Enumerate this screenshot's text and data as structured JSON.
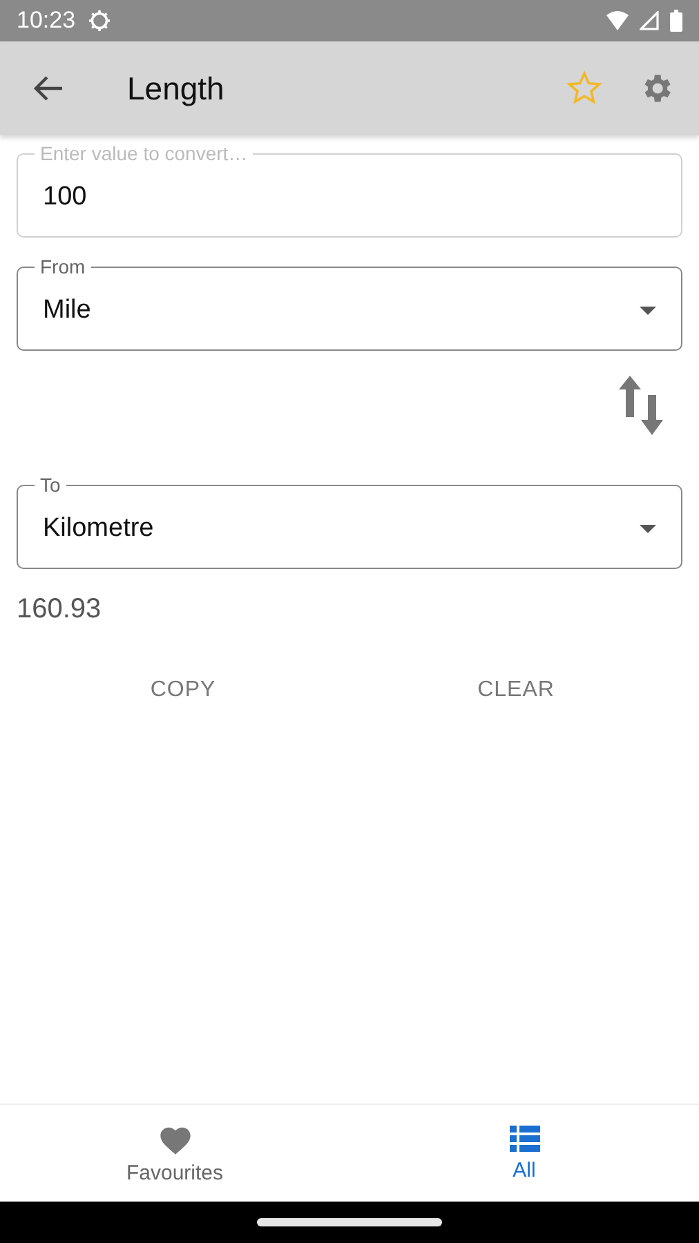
{
  "status_bar": {
    "time": "10:23"
  },
  "app_bar": {
    "title": "Length",
    "favourite": false
  },
  "value_field": {
    "label": "Enter value to convert…",
    "value": "100"
  },
  "from": {
    "label": "From",
    "value": "Mile"
  },
  "to": {
    "label": "To",
    "value": "Kilometre"
  },
  "result": "160.93",
  "buttons": [
    "COPY",
    "CLEAR"
  ],
  "bottom_nav": [
    {
      "label": "Favourites",
      "kind": "heart",
      "selected": false
    },
    {
      "label": "All",
      "kind": "list",
      "selected": true
    }
  ]
}
